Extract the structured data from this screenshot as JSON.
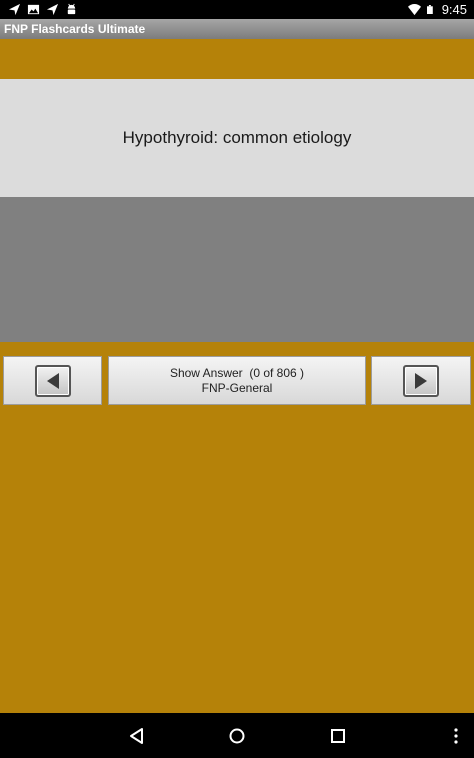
{
  "status_bar": {
    "time": "9:45",
    "left_icons": [
      "send-icon",
      "image-icon",
      "send-icon",
      "android-icon"
    ],
    "right_icons": [
      "wifi-icon",
      "battery-icon"
    ]
  },
  "app": {
    "title": "FNP Flashcards Ultimate",
    "background_color": "#b58209"
  },
  "card": {
    "question": "Hypothyroid: common etiology",
    "answer": ""
  },
  "controls": {
    "show_answer_label": "Show Answer  (0 of 806 )",
    "deck_name": "FNP-General",
    "prev_icon": "play-left-icon",
    "next_icon": "play-right-icon"
  },
  "system_nav": {
    "icons": [
      "back-icon",
      "home-icon",
      "recents-icon",
      "overflow-icon"
    ]
  }
}
